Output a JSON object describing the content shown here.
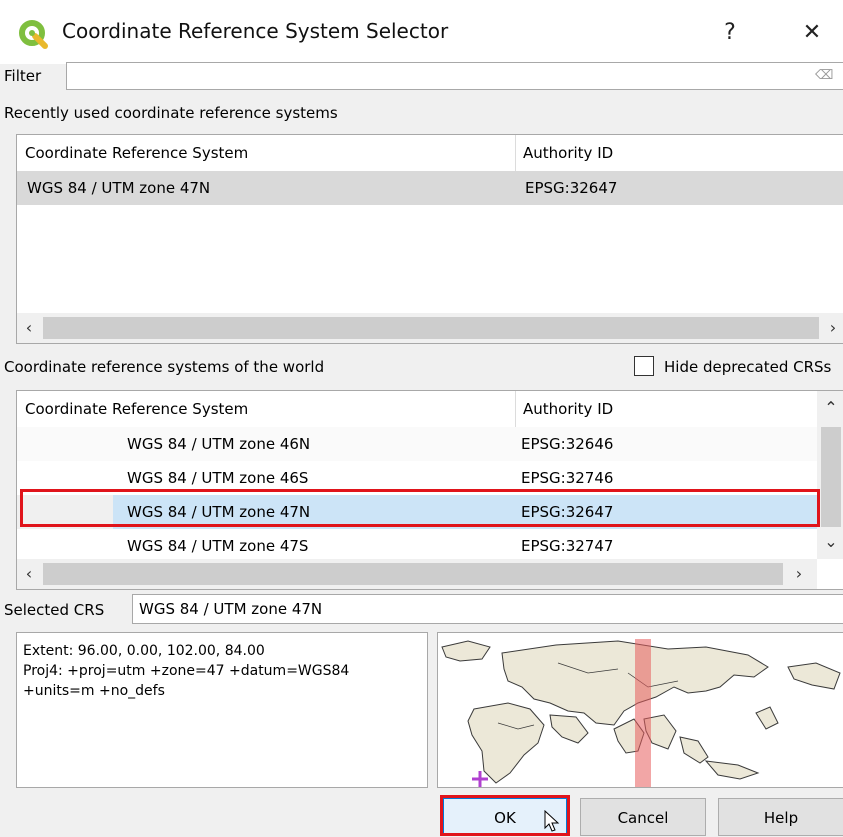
{
  "window": {
    "title": "Coordinate Reference System Selector",
    "help_glyph": "?",
    "close_glyph": "✕"
  },
  "filter": {
    "label": "Filter",
    "value": "",
    "clear_icon": "clear-icon"
  },
  "recent": {
    "section_label": "Recently used coordinate reference systems",
    "columns": [
      "Coordinate Reference System",
      "Authority ID"
    ],
    "rows": [
      {
        "name": "WGS 84 / UTM zone 47N",
        "auth": "EPSG:32647"
      }
    ]
  },
  "world": {
    "section_label": "Coordinate reference systems of the world",
    "hide_deprecated_label": "Hide deprecated CRSs",
    "hide_deprecated_checked": false,
    "columns": [
      "Coordinate Reference System",
      "Authority ID"
    ],
    "rows": [
      {
        "name": "WGS 84 / UTM zone 46N",
        "auth": "EPSG:32646"
      },
      {
        "name": "WGS 84 / UTM zone 46S",
        "auth": "EPSG:32746"
      },
      {
        "name": "WGS 84 / UTM zone 47N",
        "auth": "EPSG:32647",
        "selected": true
      },
      {
        "name": "WGS 84 / UTM zone 47S",
        "auth": "EPSG:32747"
      }
    ]
  },
  "selected": {
    "label": "Selected CRS",
    "value": "WGS 84 / UTM zone 47N",
    "info_lines": [
      "Extent: 96.00, 0.00, 102.00, 84.00",
      "Proj4: +proj=utm +zone=47 +datum=WGS84",
      "+units=m +no_defs"
    ]
  },
  "buttons": {
    "ok": "OK",
    "cancel": "Cancel",
    "help": "Help"
  },
  "colors": {
    "selection": "#cce4f7",
    "row_alt": "#d9d9d9",
    "highlight_box": "#e0141b",
    "utm_band": "#e85c5c",
    "qgis_green": "#7fbf3f"
  }
}
